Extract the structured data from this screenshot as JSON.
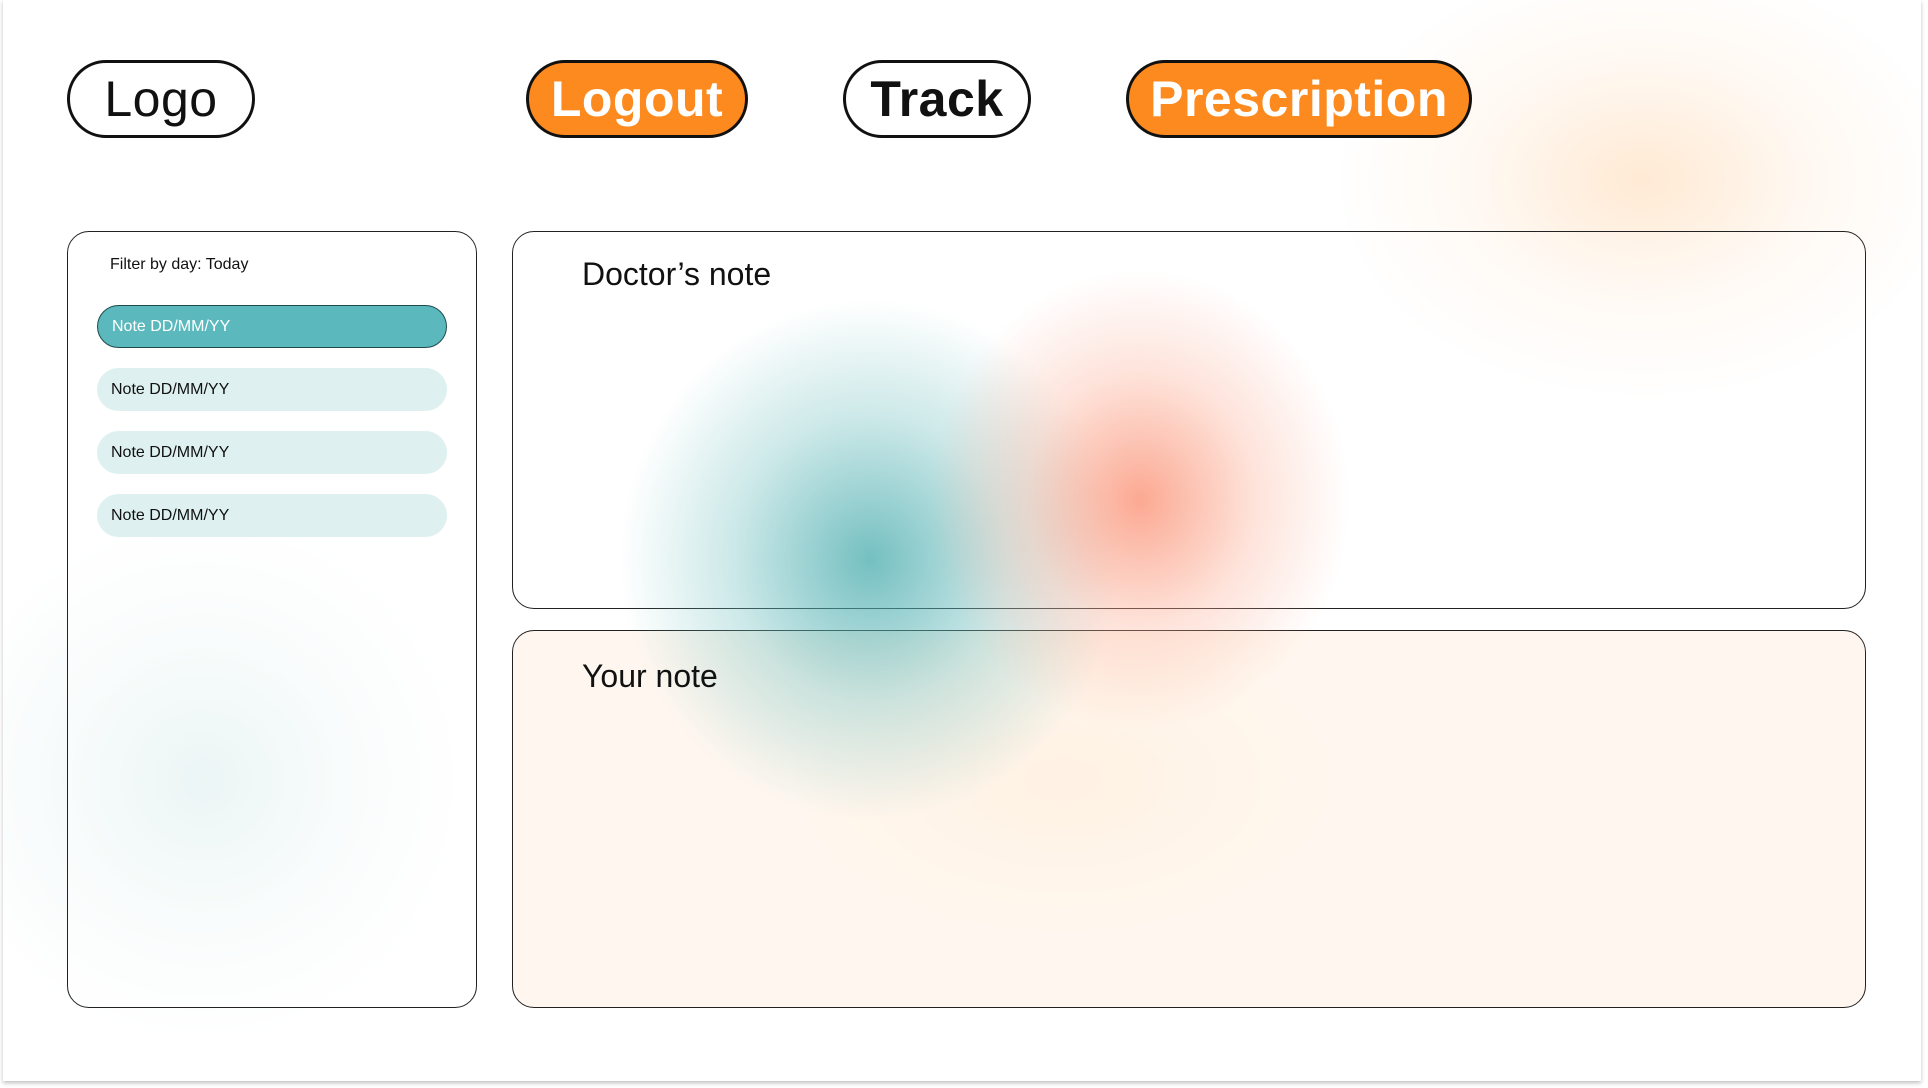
{
  "header": {
    "logo_label": "Logo",
    "logout_label": "Logout",
    "track_label": "Track",
    "prescription_label": "Prescription"
  },
  "sidebar": {
    "filter_label": "Filter by day: Today",
    "notes": [
      {
        "label": "Note  DD/MM/YY",
        "active": true
      },
      {
        "label": "Note DD/MM/YY",
        "active": false
      },
      {
        "label": "Note DD/MM/YY",
        "active": false
      },
      {
        "label": "Note DD/MM/YY",
        "active": false
      }
    ]
  },
  "main": {
    "doctor_note_title": "Doctor’s note",
    "your_note_title": "Your note"
  },
  "colors": {
    "accent_orange": "#fd8a1e",
    "accent_teal": "#5bb9be"
  }
}
